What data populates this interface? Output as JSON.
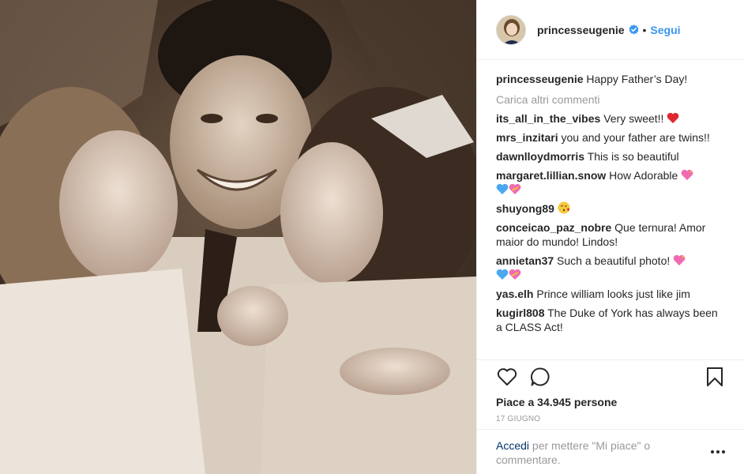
{
  "profile": {
    "username": "princesseugenie",
    "follow_label": "Segui",
    "separator": "•"
  },
  "caption": {
    "user": "princesseugenie",
    "text": "Happy Father’s Day!"
  },
  "load_more_label": "Carica altri commenti",
  "comments": [
    {
      "user": "its_all_in_the_vibes",
      "text": "Very sweet!!",
      "emoji": "red-heart"
    },
    {
      "user": "mrs_inzitari",
      "text": "you and your father are twins!!",
      "emoji": ""
    },
    {
      "user": "dawnlloydmorris",
      "text": "This is so beautiful",
      "emoji": ""
    },
    {
      "user": "margaret.lillian.snow",
      "text": "How Adorable",
      "emoji": "hearts"
    },
    {
      "user": "shuyong89",
      "text": "",
      "emoji": "kiss-face"
    },
    {
      "user": "conceicao_paz_nobre",
      "text": "Que ternura! Amor maior do mundo! Lindos!",
      "emoji": ""
    },
    {
      "user": "annietan37",
      "text": "Such a beautiful photo!",
      "emoji": "hearts"
    },
    {
      "user": "yas.elh",
      "text": "Prince william looks just like jim",
      "emoji": ""
    },
    {
      "user": "kugirl808",
      "text": "The Duke of York has always been a CLASS Act!",
      "emoji": ""
    }
  ],
  "likes_text": "Piace a 34.945 persone",
  "date_text": "17 GIUGNO",
  "login": {
    "link_text": "Accedi",
    "rest_text": "per mettere \"Mi piace\" o commentare."
  },
  "colors": {
    "link_blue": "#3897f0",
    "verified_blue": "#3897f0",
    "muted_gray": "#999999",
    "text": "#262626",
    "heart_red": "#ed4956",
    "pink_heart": "#f06bb0",
    "blue_heart": "#4aa8f0"
  },
  "icons": {
    "like": "heart-outline-icon",
    "comment": "speech-bubble-icon",
    "save": "bookmark-icon",
    "more": "more-dots-icon",
    "verified": "verified-badge-icon"
  }
}
